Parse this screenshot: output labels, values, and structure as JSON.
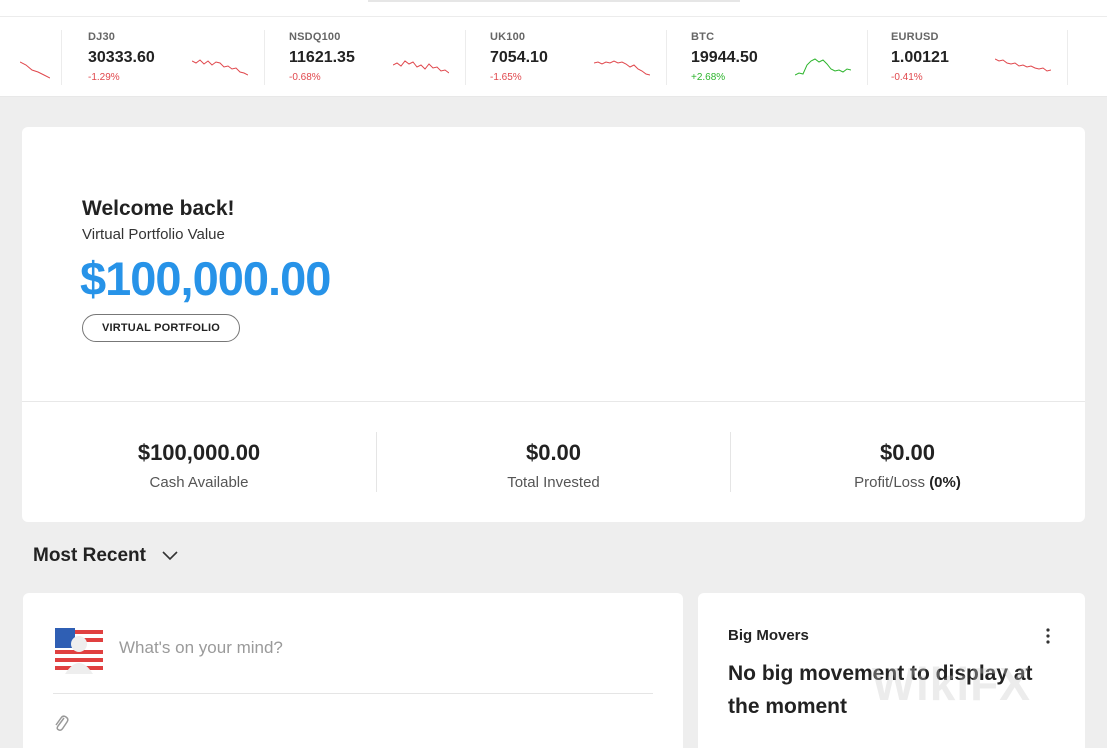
{
  "ticker": [
    {
      "symbol": "DJ30",
      "price": "30333.60",
      "change": "-1.29%",
      "direction": "down"
    },
    {
      "symbol": "NSDQ100",
      "price": "11621.35",
      "change": "-0.68%",
      "direction": "down"
    },
    {
      "symbol": "UK100",
      "price": "7054.10",
      "change": "-1.65%",
      "direction": "down"
    },
    {
      "symbol": "BTC",
      "price": "19944.50",
      "change": "+2.68%",
      "direction": "up"
    },
    {
      "symbol": "EURUSD",
      "price": "1.00121",
      "change": "-0.41%",
      "direction": "down"
    }
  ],
  "colors": {
    "accent": "#2793e8",
    "negative": "#e0474c",
    "positive": "#2db52d"
  },
  "portfolio": {
    "greeting": "Welcome back!",
    "subtitle": "Virtual Portfolio Value",
    "value": "$100,000.00",
    "mode_button": "VIRTUAL PORTFOLIO"
  },
  "stats": [
    {
      "value": "$100,000.00",
      "label": "Cash Available"
    },
    {
      "value": "$0.00",
      "label": "Total Invested"
    },
    {
      "value": "$0.00",
      "label": "Profit/Loss",
      "extra": "(0%)"
    }
  ],
  "feed": {
    "filter_label": "Most Recent",
    "filter_icon": "chevron-down-icon",
    "composer_placeholder": "What's on your mind?",
    "attach_icon": "paperclip-icon"
  },
  "big_movers": {
    "title": "Big Movers",
    "message": "No big movement to display at the moment",
    "menu_icon": "more-vertical-icon"
  },
  "watermark": "WikiFX"
}
